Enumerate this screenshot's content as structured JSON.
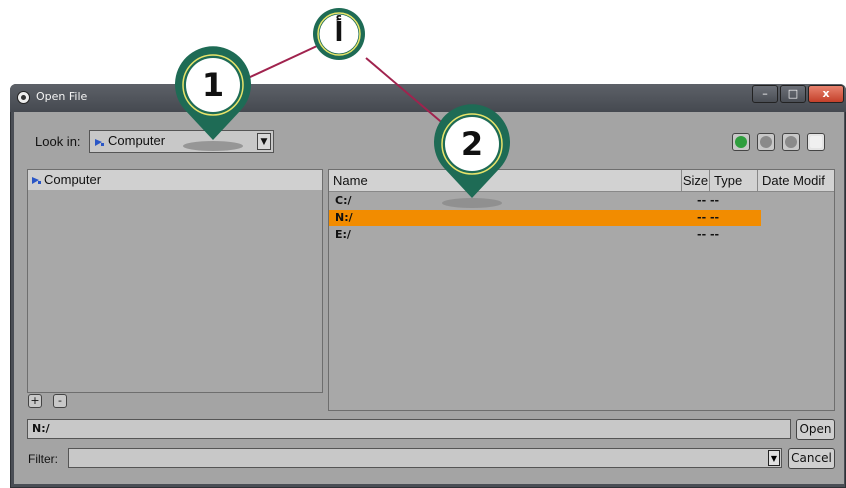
{
  "window": {
    "title": "Open File"
  },
  "controls": {
    "minimize": "–",
    "maximize": "□",
    "close": "x"
  },
  "lookin": {
    "label": "Look in:",
    "value": "Computer",
    "arrow": "▼"
  },
  "nav_buttons": [
    "back-icon",
    "forward-icon",
    "up-icon",
    "new-folder-icon"
  ],
  "sidebar": {
    "items": [
      {
        "label": "Computer",
        "icon": "computer-icon"
      }
    ],
    "add_label": "+",
    "remove_label": "-"
  },
  "filelist": {
    "columns": [
      "Name",
      "Size",
      "Type",
      "Date Modif"
    ],
    "rows": [
      {
        "name": "C:/",
        "size": "-- --",
        "selected": false
      },
      {
        "name": "N:/",
        "size": "-- --",
        "selected": true
      },
      {
        "name": "E:/",
        "size": "-- --",
        "selected": false
      }
    ]
  },
  "path_field": {
    "value": "N:/"
  },
  "buttons": {
    "open": "Open",
    "cancel": "Cancel"
  },
  "filter": {
    "label": "Filter:",
    "arrow": "▼"
  },
  "callouts": {
    "top": "أ",
    "one": "1",
    "two": "2"
  },
  "colors": {
    "selection": "#f28c00",
    "callout": "#1e6b55",
    "callout_ring": "#e8e46a",
    "connector": "#a0234e"
  }
}
